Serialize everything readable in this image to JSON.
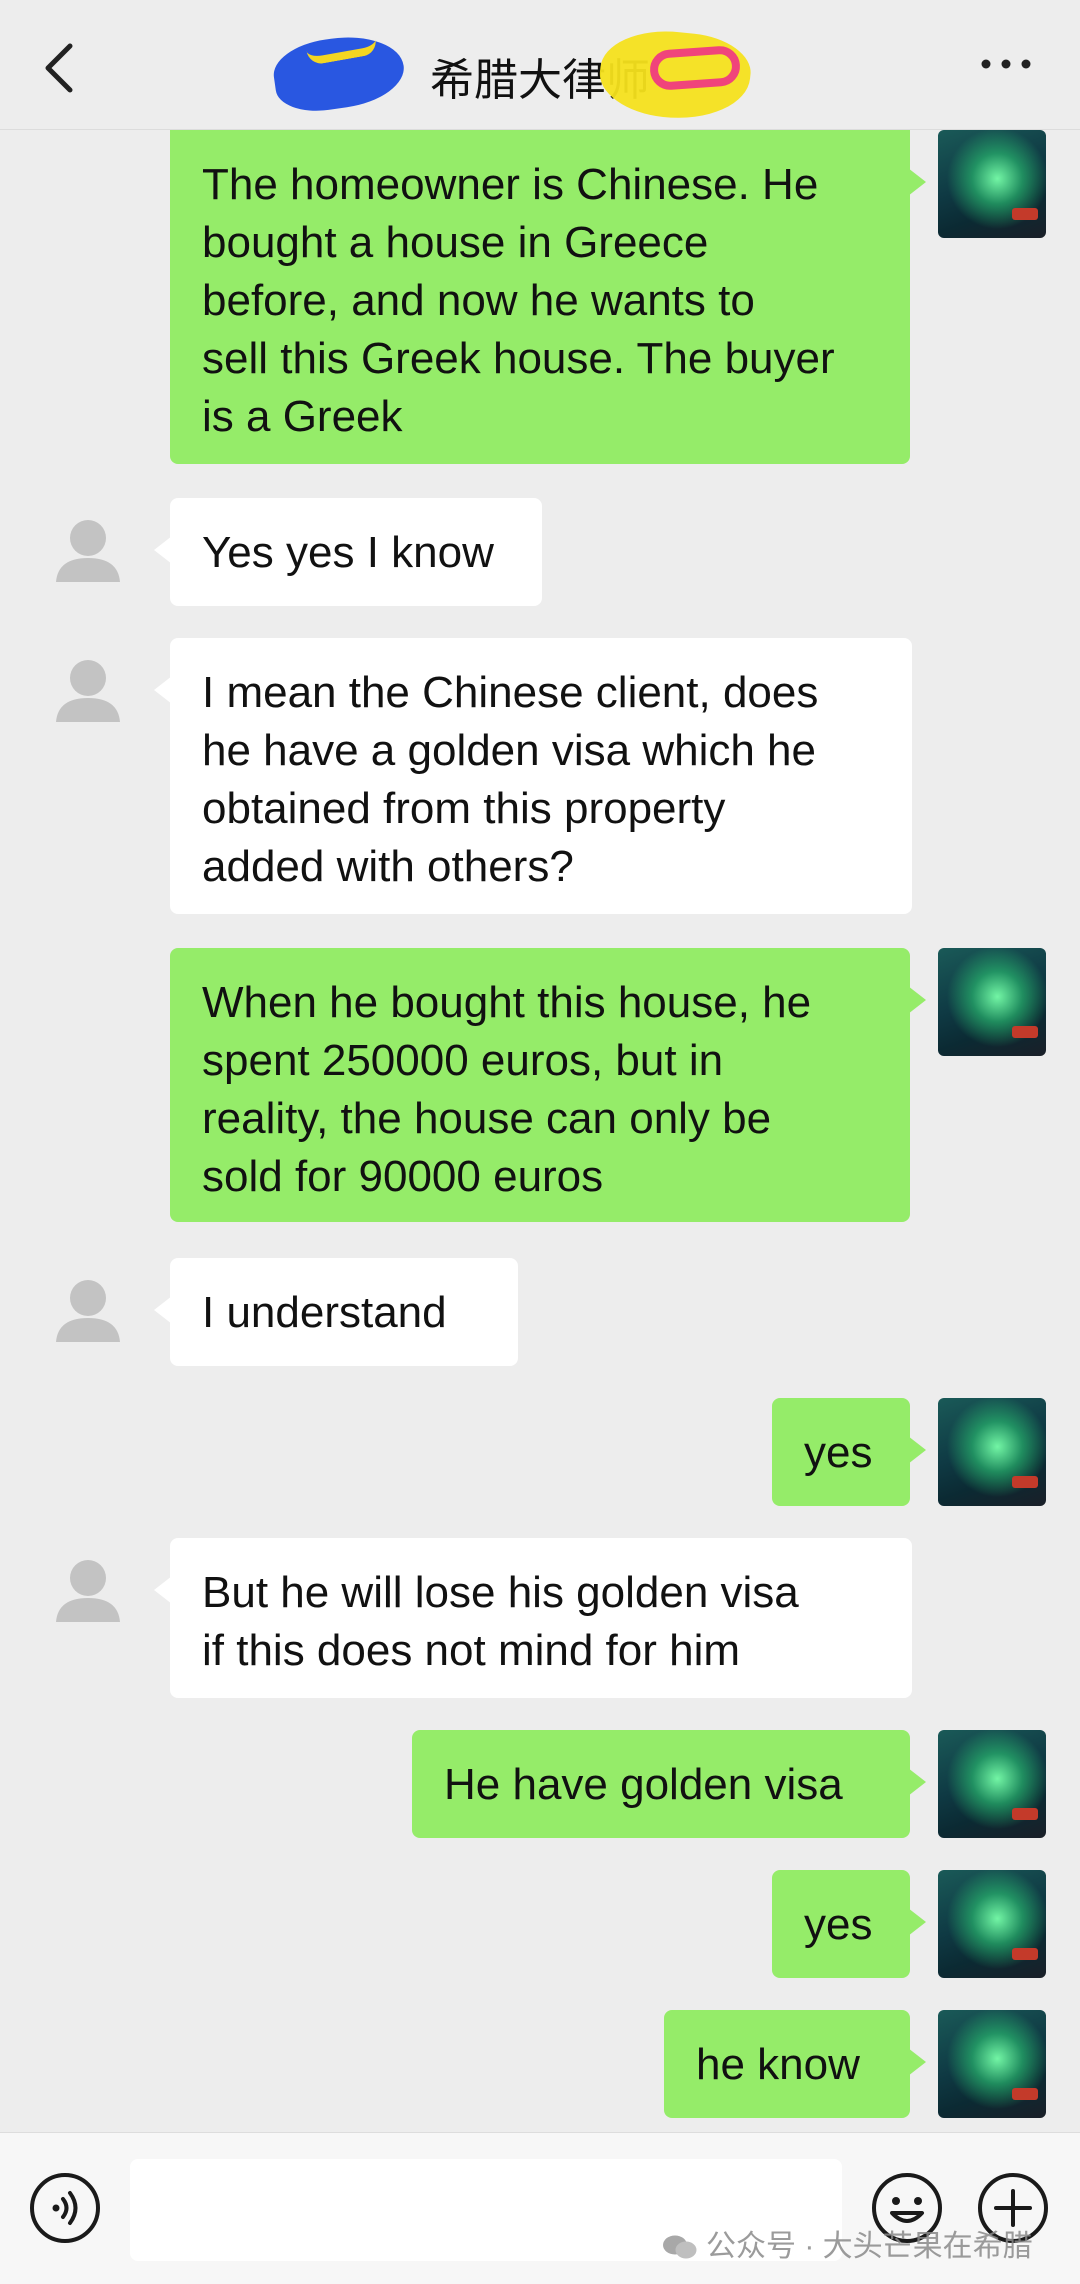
{
  "header": {
    "title": "希腊大律师",
    "back_icon": "chevron-left-icon",
    "more_icon": "more-dots-icon"
  },
  "messages": [
    {
      "sender": "me",
      "text": "The homeowner is Chinese. He\nbought a house in Greece\nbefore, and now he wants to\nsell this Greek house. The buyer\nis a Greek"
    },
    {
      "sender": "other",
      "text": "Yes yes I know"
    },
    {
      "sender": "other",
      "text": "I mean the Chinese client, does\nhe have a golden visa which he\nobtained from this property\nadded with others?"
    },
    {
      "sender": "me",
      "text": "When he bought this house, he\nspent 250000 euros, but in\nreality, the house can only be\nsold for 90000 euros"
    },
    {
      "sender": "other",
      "text": "I understand"
    },
    {
      "sender": "me",
      "text": "yes"
    },
    {
      "sender": "other",
      "text": "But he will lose his golden visa\nif this does not mind for him"
    },
    {
      "sender": "me",
      "text": "He have golden visa"
    },
    {
      "sender": "me",
      "text": "yes"
    },
    {
      "sender": "me",
      "text": "he know"
    }
  ],
  "footer": {
    "voice_icon": "voice-icon",
    "emoji_icon": "emoji-icon",
    "plus_icon": "plus-icon",
    "input_value": "",
    "watermark": "公众号 · 大头芒果在希腊"
  },
  "colors": {
    "background": "#ededed",
    "my_bubble": "#95ec69",
    "their_bubble": "#ffffff"
  }
}
